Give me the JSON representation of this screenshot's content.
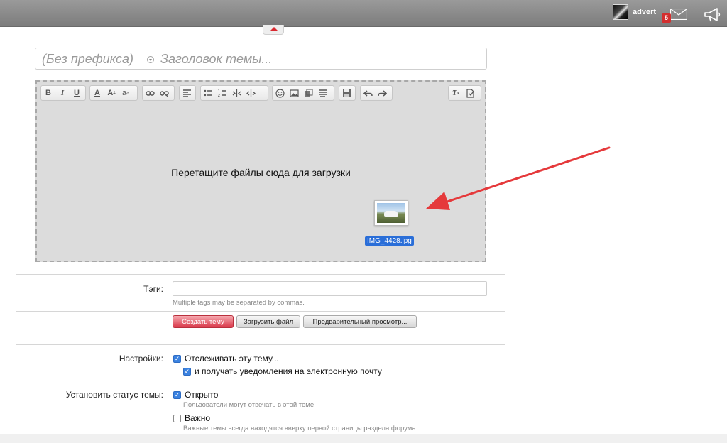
{
  "topbar": {
    "username": "advert",
    "mail_count": "5",
    "icons": [
      "avatar",
      "mail-icon",
      "megaphone-icon"
    ]
  },
  "thread": {
    "prefix": "(Без префикса)",
    "title_placeholder": "Заголовок темы..."
  },
  "editor": {
    "dropzone_text": "Перетащите файлы сюда для загрузки",
    "dragged_file": "IMG_4428.jpg",
    "toolbar_icons": [
      "bold-icon",
      "italic-icon",
      "underline-icon",
      "text-color-icon",
      "font-size-icon",
      "font-family-icon",
      "link-icon",
      "unlink-icon",
      "align-icon",
      "bulleted-list-icon",
      "numbered-list-icon",
      "outdent-icon",
      "indent-icon",
      "smilie-icon",
      "image-icon",
      "media-icon",
      "quote-icon",
      "save-draft-icon",
      "undo-icon",
      "redo-icon",
      "remove-format-icon",
      "toggle-bbcode-icon"
    ]
  },
  "tags": {
    "label": "Тэги:",
    "hint": "Multiple tags may be separated by commas."
  },
  "buttons": {
    "create": "Создать тему",
    "upload": "Загрузить файл",
    "preview": "Предварительный просмотр..."
  },
  "settings": {
    "label": "Настройки:",
    "watch": "Отслеживать эту тему...",
    "email": "и получать уведомления на электронную почту"
  },
  "status": {
    "label": "Установить статус темы:",
    "open": "Открыто",
    "open_hint": "Пользователи могут отвечать в этой теме",
    "sticky": "Важно",
    "sticky_hint": "Важные темы всегда находятся вверху первой страницы раздела форума"
  },
  "colors": {
    "accent": "#d9384a",
    "checkbox": "#3b82e0",
    "arrow": "#e5393b"
  }
}
